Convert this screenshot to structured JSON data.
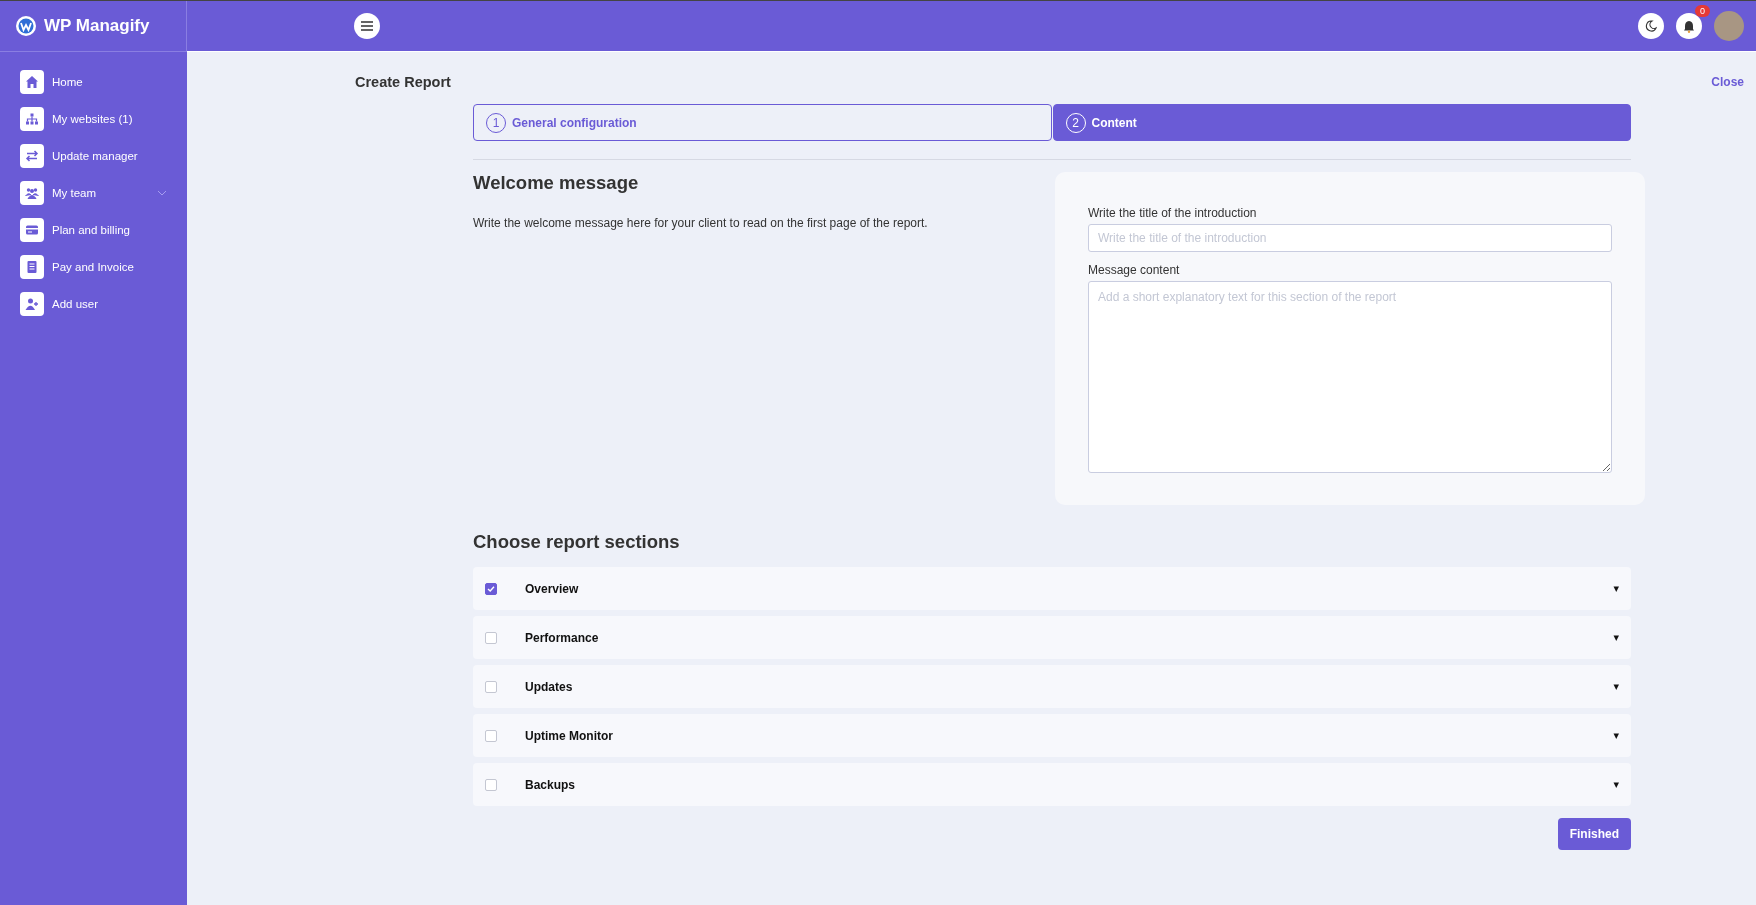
{
  "brand": {
    "name": "WP Managify"
  },
  "sidebar": {
    "items": [
      {
        "label": "Home",
        "kind": "home",
        "expandable": false
      },
      {
        "label": "My websites (1)",
        "kind": "sitemap",
        "expandable": false
      },
      {
        "label": "Update manager",
        "kind": "arrows",
        "expandable": false
      },
      {
        "label": "My team",
        "kind": "team",
        "expandable": true
      },
      {
        "label": "Plan and billing",
        "kind": "card",
        "expandable": false
      },
      {
        "label": "Pay and Invoice",
        "kind": "receipt",
        "expandable": false
      },
      {
        "label": "Add user",
        "kind": "user-plus",
        "expandable": false
      }
    ]
  },
  "topbar": {
    "notification_count": "0"
  },
  "page": {
    "title": "Create Report",
    "close": "Close"
  },
  "steps": [
    {
      "number": "1",
      "label": "General configuration",
      "selected": false
    },
    {
      "number": "2",
      "label": "Content",
      "selected": true
    }
  ],
  "welcome": {
    "heading": "Welcome message",
    "description": "Write the welcome message here for your client to read on the first page of the report.",
    "title_label": "Write the title of the introduction",
    "title_placeholder": "Write the title of the introduction",
    "content_label": "Message content",
    "content_placeholder": "Add a short explanatory text for this section of the report"
  },
  "sections": {
    "heading": "Choose report sections",
    "items": [
      {
        "label": "Overview",
        "checked": true,
        "toggle": "▾"
      },
      {
        "label": "Performance",
        "checked": false,
        "toggle": "▾"
      },
      {
        "label": "Updates",
        "checked": false,
        "toggle": "▾"
      },
      {
        "label": "Uptime Monitor",
        "checked": false,
        "toggle": "▾"
      },
      {
        "label": "Backups",
        "checked": false,
        "toggle": "▾"
      }
    ]
  },
  "finish_button": "Finished"
}
